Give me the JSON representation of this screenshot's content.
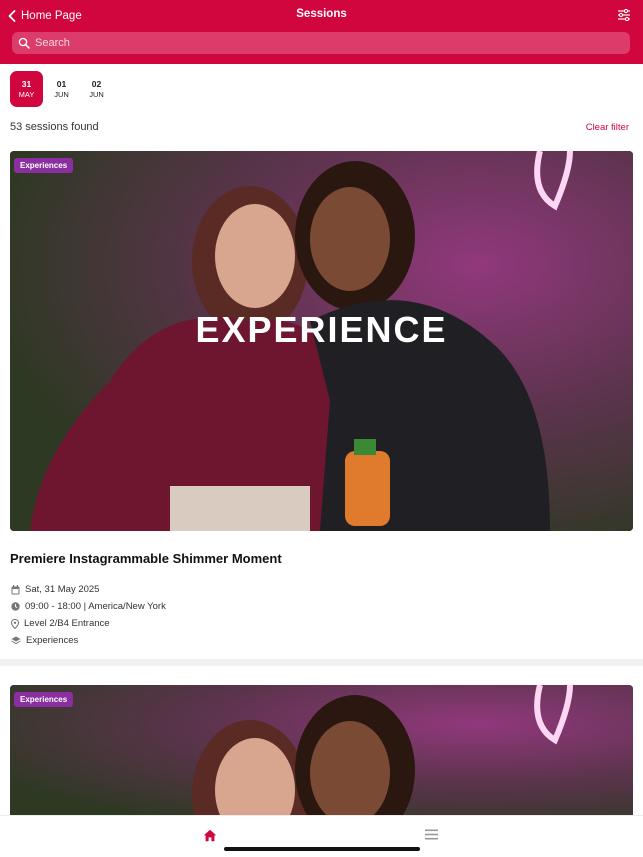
{
  "header": {
    "back_label": "Home Page",
    "title": "Sessions",
    "back_icon": "chevron-left-icon",
    "filter_icon": "sliders-icon",
    "search_placeholder": "Search",
    "accent": "#d2063f"
  },
  "dates": [
    {
      "day": "31",
      "month": "MAY",
      "active": true
    },
    {
      "day": "01",
      "month": "JUN",
      "active": false
    },
    {
      "day": "02",
      "month": "JUN",
      "active": false
    }
  ],
  "results": {
    "count_label": "53 sessions found",
    "clear_label": "Clear filter"
  },
  "sessions": [
    {
      "tag": "Experiences",
      "overlay_text": "EXPERIENCE",
      "title": "Premiere Instagrammable Shimmer Moment",
      "date": "Sat, 31 May 2025",
      "time": "09:00 - 18:00 | America/New York",
      "location": "Level 2/B4 Entrance",
      "category": "Experiences"
    },
    {
      "tag": "Experiences"
    }
  ],
  "tabbar": {
    "home_icon": "home-icon",
    "menu_icon": "menu-icon"
  }
}
